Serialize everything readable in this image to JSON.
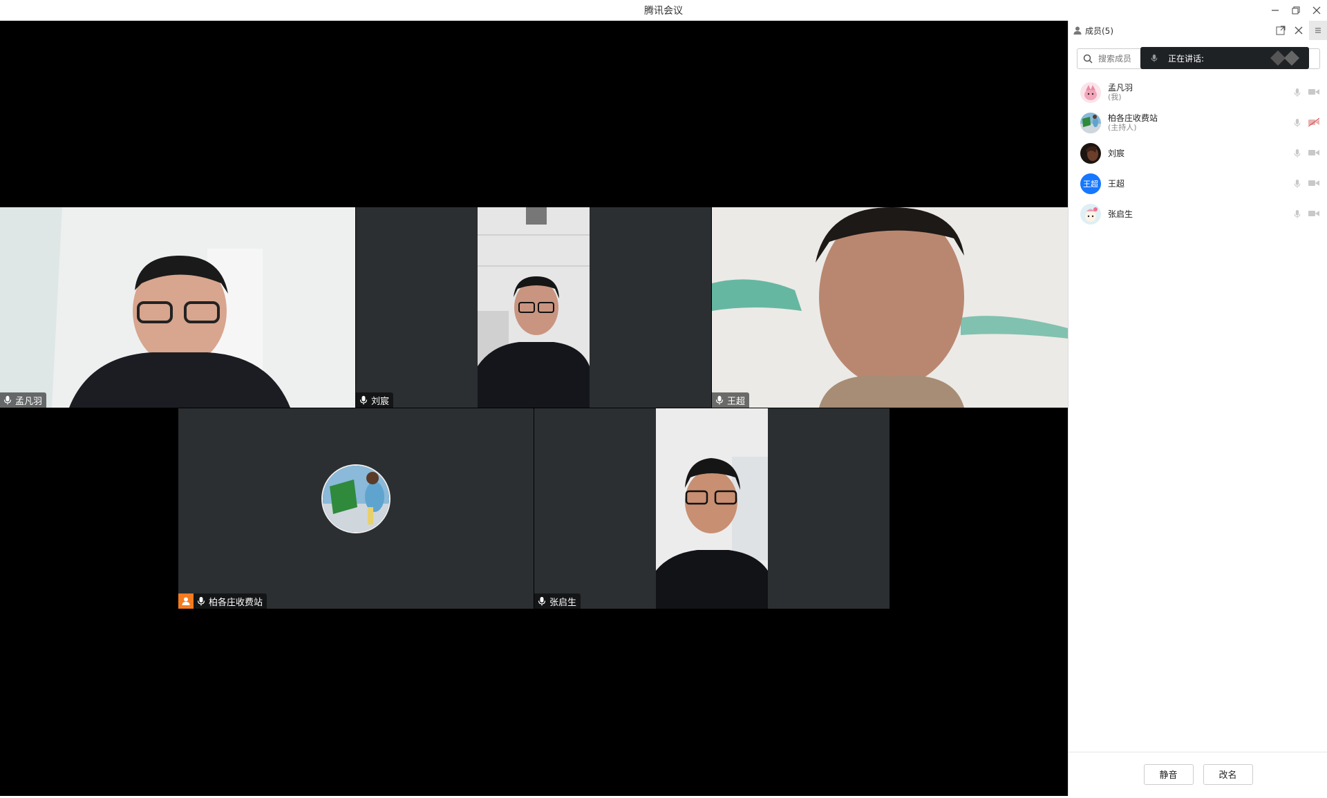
{
  "window": {
    "title": "腾讯会议"
  },
  "tiles": {
    "t1": {
      "name": "孟凡羽"
    },
    "t2": {
      "name": "刘宸"
    },
    "t3": {
      "name": "王超"
    },
    "t4": {
      "name": "柏各庄收费站"
    },
    "t5": {
      "name": "张启生"
    }
  },
  "panel": {
    "header": "成员(5)",
    "search_placeholder": "搜索成员",
    "speaking_label": "正在讲话:",
    "members": [
      {
        "name": "孟凡羽",
        "role": "(我)"
      },
      {
        "name": "柏各庄收费站",
        "role": "(主持人)"
      },
      {
        "name": "刘宸",
        "role": ""
      },
      {
        "name": "王超",
        "role": "",
        "avatar_text": "王超"
      },
      {
        "name": "张启生",
        "role": ""
      }
    ],
    "footer": {
      "mute_label": "静音",
      "rename_label": "改名"
    }
  },
  "colors": {
    "accent_blue": "#1677ff",
    "host_orange": "#f47b20",
    "tile_bg": "#2c2f31",
    "stage_bg": "#000000"
  }
}
